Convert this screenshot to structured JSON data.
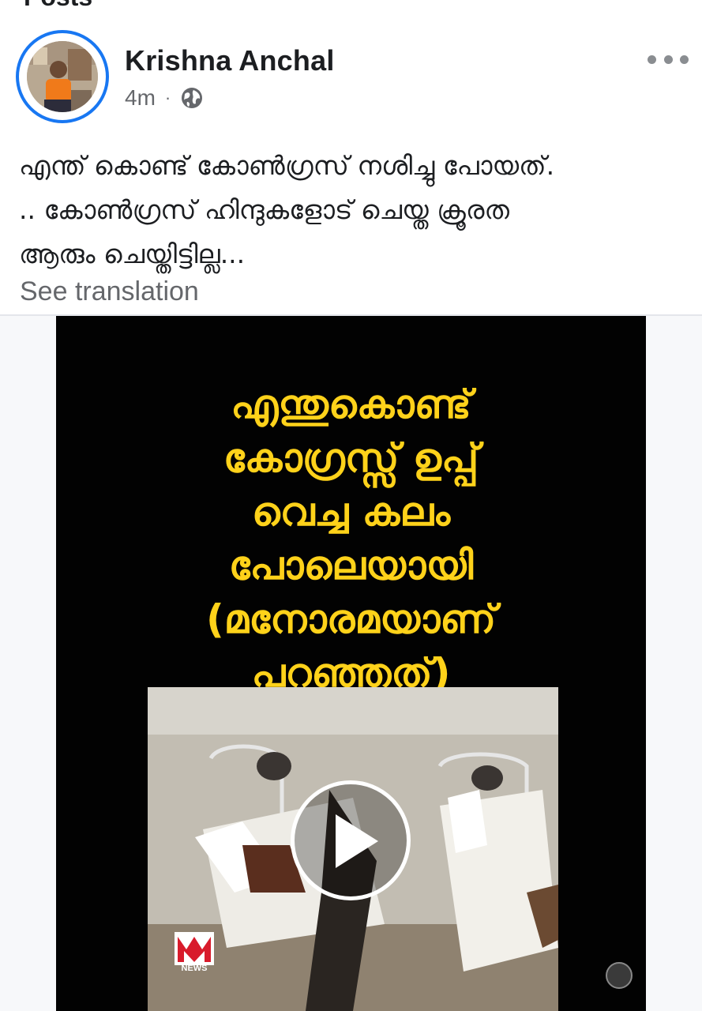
{
  "page": {
    "section_title": "Posts"
  },
  "post": {
    "author": "Krishna Anchal",
    "timestamp": "4m",
    "separator": "·",
    "privacy_icon": "globe-icon",
    "more_icon": "more-horizontal-icon",
    "text_lines": [
      "എന്ത് കൊണ്ട് കോൺഗ്രസ് നശിച്ചു പോയത്.",
      ".. കോൺഗ്രസ് ഹിന്ദുകളോട് ചെയ്ത ക്രൂരത",
      "ആരും ചെയ്തിട്ടില്ല..."
    ],
    "see_translation": "See translation"
  },
  "video": {
    "overlay_lines": [
      "എന്തുകൊണ്ട്",
      "കോഗ്രസ്സ് ഉപ്പ്",
      "വെച്ച കലം",
      "പോലെയായി",
      "(മനോരമയാണ്",
      "പറഞ്ഞത്)"
    ],
    "play_icon": "play-icon",
    "channel_logo_text": "NEWS",
    "overlay_color": "#ffd21a"
  },
  "colors": {
    "accent": "#1877f2",
    "secondary_text": "#65676b"
  }
}
